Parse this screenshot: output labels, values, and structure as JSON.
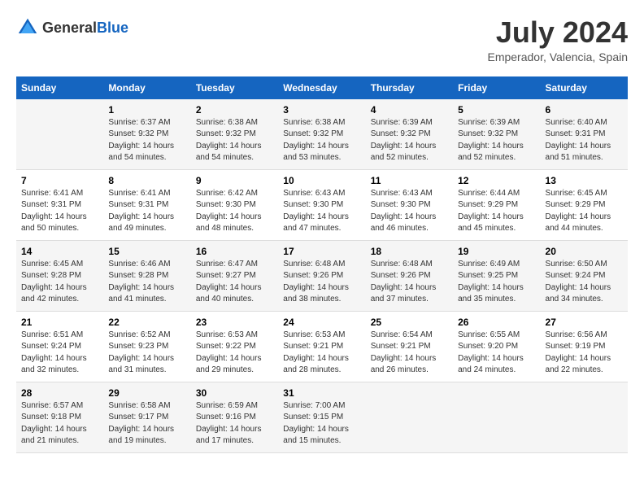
{
  "logo": {
    "text_general": "General",
    "text_blue": "Blue"
  },
  "header": {
    "month_year": "July 2024",
    "location": "Emperador, Valencia, Spain"
  },
  "days_of_week": [
    "Sunday",
    "Monday",
    "Tuesday",
    "Wednesday",
    "Thursday",
    "Friday",
    "Saturday"
  ],
  "weeks": [
    [
      {
        "day": "",
        "info": ""
      },
      {
        "day": "1",
        "info": "Sunrise: 6:37 AM\nSunset: 9:32 PM\nDaylight: 14 hours\nand 54 minutes."
      },
      {
        "day": "2",
        "info": "Sunrise: 6:38 AM\nSunset: 9:32 PM\nDaylight: 14 hours\nand 54 minutes."
      },
      {
        "day": "3",
        "info": "Sunrise: 6:38 AM\nSunset: 9:32 PM\nDaylight: 14 hours\nand 53 minutes."
      },
      {
        "day": "4",
        "info": "Sunrise: 6:39 AM\nSunset: 9:32 PM\nDaylight: 14 hours\nand 52 minutes."
      },
      {
        "day": "5",
        "info": "Sunrise: 6:39 AM\nSunset: 9:32 PM\nDaylight: 14 hours\nand 52 minutes."
      },
      {
        "day": "6",
        "info": "Sunrise: 6:40 AM\nSunset: 9:31 PM\nDaylight: 14 hours\nand 51 minutes."
      }
    ],
    [
      {
        "day": "7",
        "info": "Sunrise: 6:41 AM\nSunset: 9:31 PM\nDaylight: 14 hours\nand 50 minutes."
      },
      {
        "day": "8",
        "info": "Sunrise: 6:41 AM\nSunset: 9:31 PM\nDaylight: 14 hours\nand 49 minutes."
      },
      {
        "day": "9",
        "info": "Sunrise: 6:42 AM\nSunset: 9:30 PM\nDaylight: 14 hours\nand 48 minutes."
      },
      {
        "day": "10",
        "info": "Sunrise: 6:43 AM\nSunset: 9:30 PM\nDaylight: 14 hours\nand 47 minutes."
      },
      {
        "day": "11",
        "info": "Sunrise: 6:43 AM\nSunset: 9:30 PM\nDaylight: 14 hours\nand 46 minutes."
      },
      {
        "day": "12",
        "info": "Sunrise: 6:44 AM\nSunset: 9:29 PM\nDaylight: 14 hours\nand 45 minutes."
      },
      {
        "day": "13",
        "info": "Sunrise: 6:45 AM\nSunset: 9:29 PM\nDaylight: 14 hours\nand 44 minutes."
      }
    ],
    [
      {
        "day": "14",
        "info": "Sunrise: 6:45 AM\nSunset: 9:28 PM\nDaylight: 14 hours\nand 42 minutes."
      },
      {
        "day": "15",
        "info": "Sunrise: 6:46 AM\nSunset: 9:28 PM\nDaylight: 14 hours\nand 41 minutes."
      },
      {
        "day": "16",
        "info": "Sunrise: 6:47 AM\nSunset: 9:27 PM\nDaylight: 14 hours\nand 40 minutes."
      },
      {
        "day": "17",
        "info": "Sunrise: 6:48 AM\nSunset: 9:26 PM\nDaylight: 14 hours\nand 38 minutes."
      },
      {
        "day": "18",
        "info": "Sunrise: 6:48 AM\nSunset: 9:26 PM\nDaylight: 14 hours\nand 37 minutes."
      },
      {
        "day": "19",
        "info": "Sunrise: 6:49 AM\nSunset: 9:25 PM\nDaylight: 14 hours\nand 35 minutes."
      },
      {
        "day": "20",
        "info": "Sunrise: 6:50 AM\nSunset: 9:24 PM\nDaylight: 14 hours\nand 34 minutes."
      }
    ],
    [
      {
        "day": "21",
        "info": "Sunrise: 6:51 AM\nSunset: 9:24 PM\nDaylight: 14 hours\nand 32 minutes."
      },
      {
        "day": "22",
        "info": "Sunrise: 6:52 AM\nSunset: 9:23 PM\nDaylight: 14 hours\nand 31 minutes."
      },
      {
        "day": "23",
        "info": "Sunrise: 6:53 AM\nSunset: 9:22 PM\nDaylight: 14 hours\nand 29 minutes."
      },
      {
        "day": "24",
        "info": "Sunrise: 6:53 AM\nSunset: 9:21 PM\nDaylight: 14 hours\nand 28 minutes."
      },
      {
        "day": "25",
        "info": "Sunrise: 6:54 AM\nSunset: 9:21 PM\nDaylight: 14 hours\nand 26 minutes."
      },
      {
        "day": "26",
        "info": "Sunrise: 6:55 AM\nSunset: 9:20 PM\nDaylight: 14 hours\nand 24 minutes."
      },
      {
        "day": "27",
        "info": "Sunrise: 6:56 AM\nSunset: 9:19 PM\nDaylight: 14 hours\nand 22 minutes."
      }
    ],
    [
      {
        "day": "28",
        "info": "Sunrise: 6:57 AM\nSunset: 9:18 PM\nDaylight: 14 hours\nand 21 minutes."
      },
      {
        "day": "29",
        "info": "Sunrise: 6:58 AM\nSunset: 9:17 PM\nDaylight: 14 hours\nand 19 minutes."
      },
      {
        "day": "30",
        "info": "Sunrise: 6:59 AM\nSunset: 9:16 PM\nDaylight: 14 hours\nand 17 minutes."
      },
      {
        "day": "31",
        "info": "Sunrise: 7:00 AM\nSunset: 9:15 PM\nDaylight: 14 hours\nand 15 minutes."
      },
      {
        "day": "",
        "info": ""
      },
      {
        "day": "",
        "info": ""
      },
      {
        "day": "",
        "info": ""
      }
    ]
  ]
}
